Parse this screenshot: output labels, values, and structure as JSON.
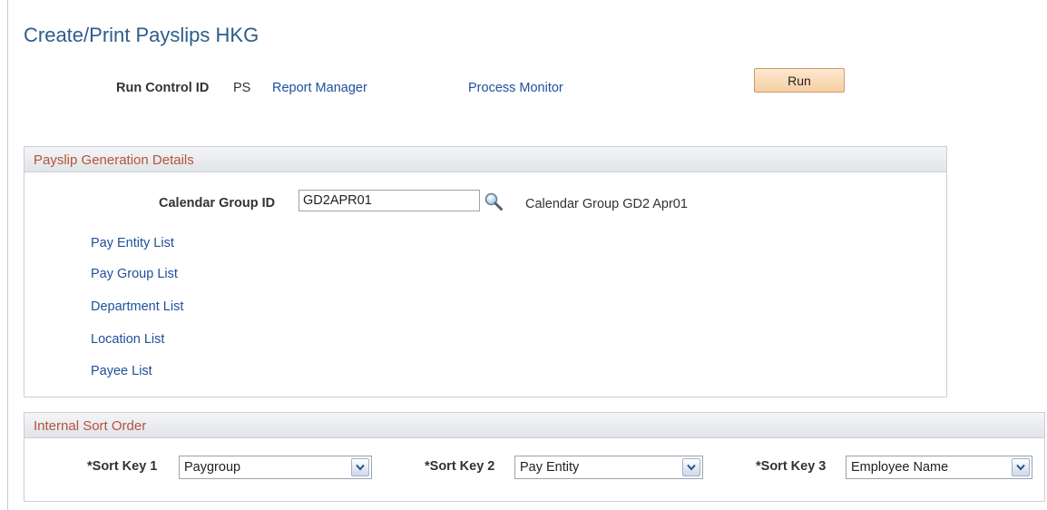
{
  "page": {
    "title": "Create/Print Payslips HKG"
  },
  "run_control": {
    "label": "Run Control ID",
    "value": "PS",
    "report_manager_link": "Report Manager",
    "process_monitor_link": "Process Monitor",
    "run_button_label": "Run"
  },
  "payslip_details": {
    "header": "Payslip Generation Details",
    "calendar_group_label": "Calendar Group ID",
    "calendar_group_value": "GD2APR01",
    "calendar_group_description": "Calendar Group GD2 Apr01",
    "lookup_icon": "magnifier-lookup-icon",
    "links": [
      "Pay Entity List",
      "Pay Group List",
      "Department List",
      "Location List",
      "Payee List"
    ]
  },
  "sort_order": {
    "header": "Internal Sort Order",
    "keys": [
      {
        "label": "*Sort Key 1",
        "value": "Paygroup"
      },
      {
        "label": "*Sort Key 2",
        "value": "Pay Entity"
      },
      {
        "label": "*Sort Key 3",
        "value": "Employee Name"
      }
    ],
    "dropdown_icon": "chevron-down-icon"
  },
  "colors": {
    "title": "#2e5d8c",
    "link": "#1f4f9c",
    "group_header_text": "#b5533c",
    "run_button": "#f6cfa3"
  }
}
